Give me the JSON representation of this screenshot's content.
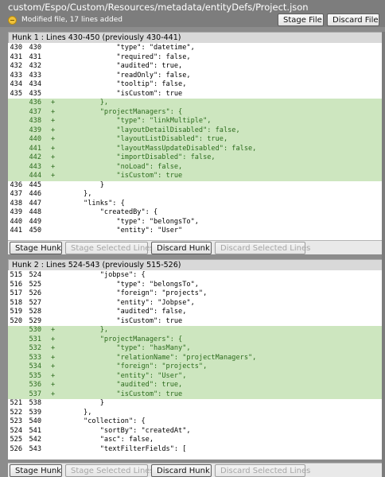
{
  "file": {
    "path": "custom/Espo/Custom/Resources/metadata/entityDefs/Project.json",
    "status": "Modified file, 17 lines added",
    "status_icon": "modified-file-icon"
  },
  "toolbar": {
    "stage_file": "Stage File",
    "discard_file": "Discard File"
  },
  "hunk_actions": {
    "stage_hunk": "Stage Hunk",
    "stage_selected": "Stage Selected Lines",
    "discard_hunk": "Discard Hunk",
    "discard_selected": "Discard Selected Lines"
  },
  "hunks": [
    {
      "title": "Hunk 1 : Lines 430-450 (previously 430-441)",
      "lines": [
        {
          "old": "430",
          "new": "430",
          "mark": "",
          "text": "              \"type\": \"datetime\","
        },
        {
          "old": "431",
          "new": "431",
          "mark": "",
          "text": "              \"required\": false,"
        },
        {
          "old": "432",
          "new": "432",
          "mark": "",
          "text": "              \"audited\": true,"
        },
        {
          "old": "433",
          "new": "433",
          "mark": "",
          "text": "              \"readOnly\": false,"
        },
        {
          "old": "434",
          "new": "434",
          "mark": "",
          "text": "              \"tooltip\": false,"
        },
        {
          "old": "435",
          "new": "435",
          "mark": "",
          "text": "              \"isCustom\": true"
        },
        {
          "old": "",
          "new": "436",
          "mark": "+",
          "text": "          },"
        },
        {
          "old": "",
          "new": "437",
          "mark": "+",
          "text": "          \"projectManagers\": {"
        },
        {
          "old": "",
          "new": "438",
          "mark": "+",
          "text": "              \"type\": \"linkMultiple\","
        },
        {
          "old": "",
          "new": "439",
          "mark": "+",
          "text": "              \"layoutDetailDisabled\": false,"
        },
        {
          "old": "",
          "new": "440",
          "mark": "+",
          "text": "              \"layoutListDisabled\": true,"
        },
        {
          "old": "",
          "new": "441",
          "mark": "+",
          "text": "              \"layoutMassUpdateDisabled\": false,"
        },
        {
          "old": "",
          "new": "442",
          "mark": "+",
          "text": "              \"importDisabled\": false,"
        },
        {
          "old": "",
          "new": "443",
          "mark": "+",
          "text": "              \"noLoad\": false,"
        },
        {
          "old": "",
          "new": "444",
          "mark": "+",
          "text": "              \"isCustom\": true"
        },
        {
          "old": "436",
          "new": "445",
          "mark": "",
          "text": "          }"
        },
        {
          "old": "437",
          "new": "446",
          "mark": "",
          "text": "      },"
        },
        {
          "old": "438",
          "new": "447",
          "mark": "",
          "text": "      \"links\": {"
        },
        {
          "old": "439",
          "new": "448",
          "mark": "",
          "text": "          \"createdBy\": {"
        },
        {
          "old": "440",
          "new": "449",
          "mark": "",
          "text": "              \"type\": \"belongsTo\","
        },
        {
          "old": "441",
          "new": "450",
          "mark": "",
          "text": "              \"entity\": \"User\""
        }
      ]
    },
    {
      "title": "Hunk 2 : Lines 524-543 (previously 515-526)",
      "lines": [
        {
          "old": "515",
          "new": "524",
          "mark": "",
          "text": "          \"jobpse\": {"
        },
        {
          "old": "516",
          "new": "525",
          "mark": "",
          "text": "              \"type\": \"belongsTo\","
        },
        {
          "old": "517",
          "new": "526",
          "mark": "",
          "text": "              \"foreign\": \"projects\","
        },
        {
          "old": "518",
          "new": "527",
          "mark": "",
          "text": "              \"entity\": \"Jobpse\","
        },
        {
          "old": "519",
          "new": "528",
          "mark": "",
          "text": "              \"audited\": false,"
        },
        {
          "old": "520",
          "new": "529",
          "mark": "",
          "text": "              \"isCustom\": true"
        },
        {
          "old": "",
          "new": "530",
          "mark": "+",
          "text": "          },"
        },
        {
          "old": "",
          "new": "531",
          "mark": "+",
          "text": "          \"projectManagers\": {"
        },
        {
          "old": "",
          "new": "532",
          "mark": "+",
          "text": "              \"type\": \"hasMany\","
        },
        {
          "old": "",
          "new": "533",
          "mark": "+",
          "text": "              \"relationName\": \"projectManagers\","
        },
        {
          "old": "",
          "new": "534",
          "mark": "+",
          "text": "              \"foreign\": \"projects\","
        },
        {
          "old": "",
          "new": "535",
          "mark": "+",
          "text": "              \"entity\": \"User\","
        },
        {
          "old": "",
          "new": "536",
          "mark": "+",
          "text": "              \"audited\": true,"
        },
        {
          "old": "",
          "new": "537",
          "mark": "+",
          "text": "              \"isCustom\": true"
        },
        {
          "old": "521",
          "new": "538",
          "mark": "",
          "text": "          }"
        },
        {
          "old": "522",
          "new": "539",
          "mark": "",
          "text": "      },"
        },
        {
          "old": "523",
          "new": "540",
          "mark": "",
          "text": "      \"collection\": {"
        },
        {
          "old": "524",
          "new": "541",
          "mark": "",
          "text": "          \"sortBy\": \"createdAt\","
        },
        {
          "old": "525",
          "new": "542",
          "mark": "",
          "text": "          \"asc\": false,"
        },
        {
          "old": "526",
          "new": "543",
          "mark": "",
          "text": "          \"textFilterFields\": ["
        }
      ]
    }
  ]
}
